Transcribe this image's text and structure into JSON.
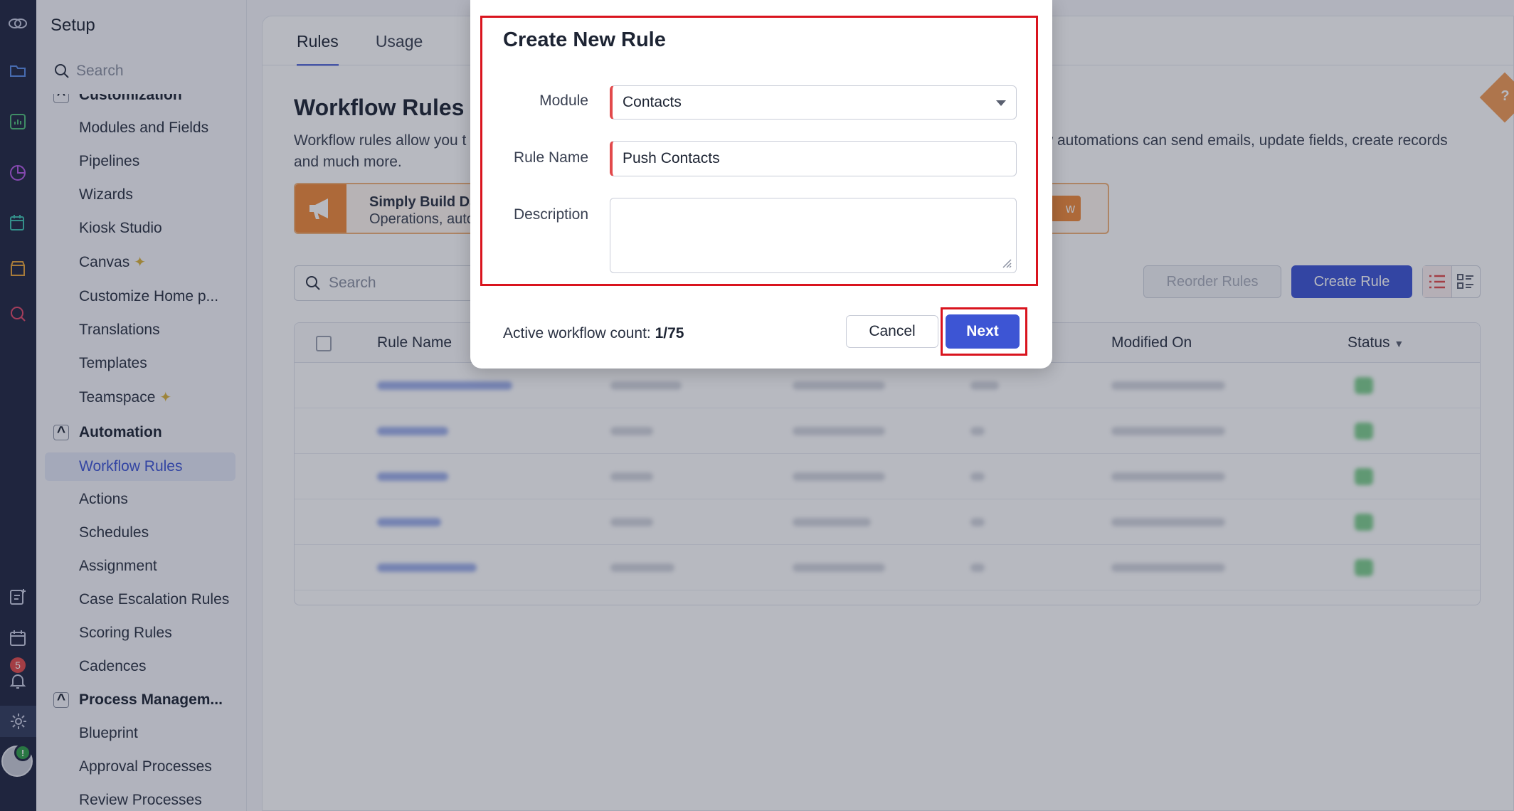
{
  "sidebar": {
    "title": "Setup",
    "search_placeholder": "Search",
    "partial_section": "Customization",
    "customization_items": [
      "Modules and Fields",
      "Pipelines",
      "Wizards",
      "Kiosk Studio",
      "Canvas",
      "Customize Home p...",
      "Translations",
      "Templates",
      "Teamspace"
    ],
    "automation_section": "Automation",
    "automation_items": [
      "Workflow Rules",
      "Actions",
      "Schedules",
      "Assignment",
      "Case Escalation Rules",
      "Scoring Rules",
      "Cadences"
    ],
    "process_section": "Process Managem...",
    "process_items": [
      "Blueprint",
      "Approval Processes",
      "Review Processes"
    ]
  },
  "rail": {
    "notification_count": "5"
  },
  "main": {
    "tabs": [
      "Rules",
      "Usage"
    ],
    "page_title": "Workflow Rules",
    "description_left": "Workflow rules allow you t",
    "description_right": "w automations can send emails, update fields, create records",
    "description_line2": "and much more.",
    "banner_line1": "Simply Build Dat",
    "banner_line2": "Operations, auto",
    "banner_button": "w",
    "search_placeholder": "Search",
    "reorder_button": "Reorder Rules",
    "create_button": "Create Rule",
    "columns": {
      "rule_name": "Rule Name",
      "modified_on": "Modified On",
      "status": "Status"
    }
  },
  "modal": {
    "title": "Create New Rule",
    "module_label": "Module",
    "module_value": "Contacts",
    "rule_name_label": "Rule Name",
    "rule_name_value": "Push Contacts",
    "description_label": "Description",
    "description_value": "",
    "count_label": "Active workflow count:",
    "count_value": "1/75",
    "cancel_label": "Cancel",
    "next_label": "Next"
  },
  "colors": {
    "accent": "#3d55d4",
    "highlight": "#d9141e",
    "banner": "#f08a38",
    "rail": "#1f2640"
  }
}
